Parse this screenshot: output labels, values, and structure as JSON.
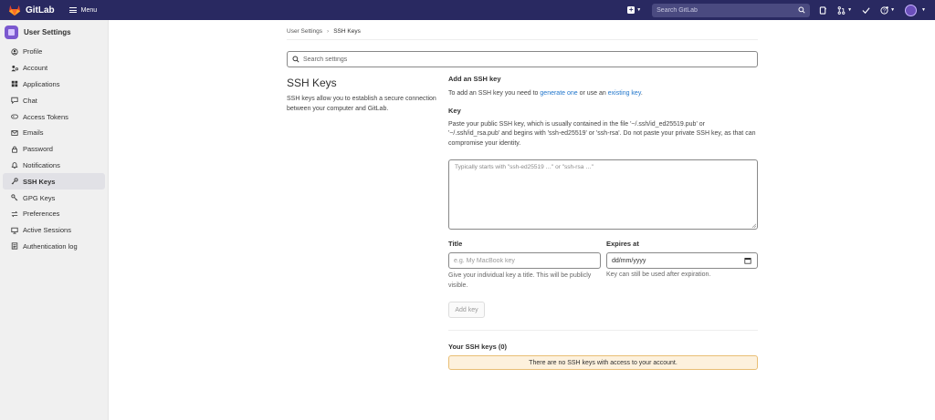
{
  "app": {
    "name": "GitLab",
    "menu_label": "Menu"
  },
  "search": {
    "placeholder": "Search GitLab"
  },
  "sidebar": {
    "title": "User Settings",
    "items": [
      {
        "label": "Profile",
        "icon": "profile-icon"
      },
      {
        "label": "Account",
        "icon": "account-icon"
      },
      {
        "label": "Applications",
        "icon": "applications-icon"
      },
      {
        "label": "Chat",
        "icon": "chat-icon"
      },
      {
        "label": "Access Tokens",
        "icon": "token-icon"
      },
      {
        "label": "Emails",
        "icon": "mail-icon"
      },
      {
        "label": "Password",
        "icon": "lock-icon"
      },
      {
        "label": "Notifications",
        "icon": "bell-icon"
      },
      {
        "label": "SSH Keys",
        "icon": "key-icon",
        "active": true
      },
      {
        "label": "GPG Keys",
        "icon": "gpg-key-icon"
      },
      {
        "label": "Preferences",
        "icon": "preferences-icon"
      },
      {
        "label": "Active Sessions",
        "icon": "monitor-icon"
      },
      {
        "label": "Authentication log",
        "icon": "log-icon"
      }
    ]
  },
  "breadcrumb": {
    "parent": "User Settings",
    "current": "SSH Keys"
  },
  "settings_search": {
    "placeholder": "Search settings"
  },
  "section": {
    "heading": "SSH Keys",
    "description": "SSH keys allow you to establish a secure connection between your computer and GitLab."
  },
  "form": {
    "add_heading": "Add an SSH key",
    "intro_prefix": "To add an SSH key you need to ",
    "generate_link": "generate one",
    "intro_mid": " or use an ",
    "existing_link": "existing key",
    "intro_suffix": ".",
    "key_label": "Key",
    "key_help": "Paste your public SSH key, which is usually contained in the file '~/.ssh/id_ed25519.pub' or '~/.ssh/id_rsa.pub' and begins with 'ssh-ed25519' or 'ssh-rsa'. Do not paste your private SSH key, as that can compromise your identity.",
    "key_placeholder": "Typically starts with \"ssh-ed25519 …\" or \"ssh-rsa …\"",
    "title_label": "Title",
    "title_placeholder": "e.g. My MacBook key",
    "title_help": "Give your individual key a title. This will be publicly visible.",
    "expires_label": "Expires at",
    "expires_value": "dd/mm/yyyy",
    "expires_help": "Key can still be used after expiration.",
    "add_button": "Add key"
  },
  "keys_list": {
    "heading": "Your SSH keys (0)",
    "empty_message": "There are no SSH keys with access to your account."
  },
  "colors": {
    "navbar": "#292961",
    "link": "#1f75cb",
    "alert_bg": "#fdf1dd",
    "alert_border": "#e9be74"
  }
}
